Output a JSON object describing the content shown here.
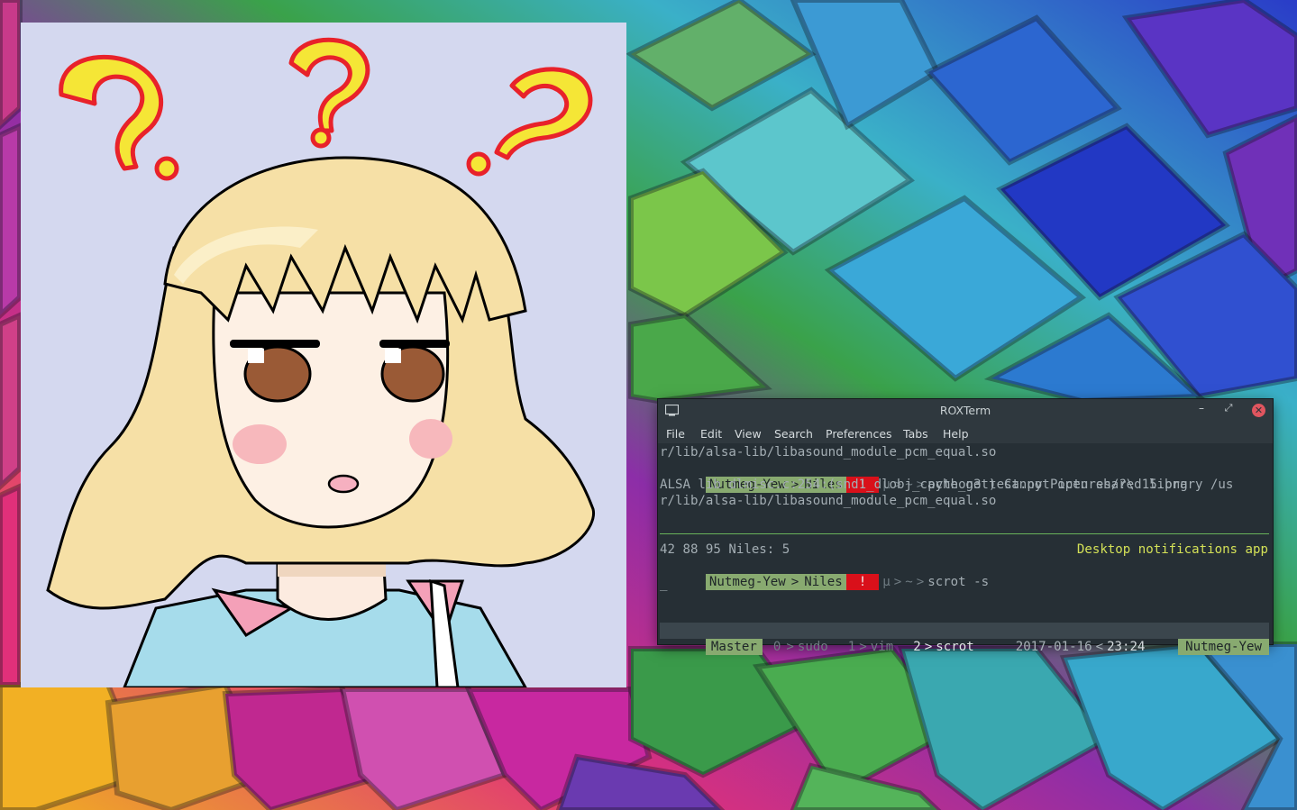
{
  "terminal": {
    "title": "ROXTerm",
    "controls": {
      "minimize": "–",
      "maximize": "⤢",
      "close": "✕"
    },
    "menu": [
      "File",
      "Edit",
      "View",
      "Search",
      "Preferences",
      "Tabs",
      "Help"
    ],
    "lines": {
      "l1": "r/lib/alsa-lib/libasound_module_pcm_equal.so",
      "l3": "ALSA lib dlmisc.c:254:(snd1_dlobj_cache_get) Cannot open shared library /us",
      "l4": "r/lib/alsa-lib/libasound_module_pcm_equal.so",
      "stats": "42 88 95 Niles: 5",
      "notification": "Desktop notifications app",
      "cursor": "_"
    },
    "prompt": {
      "host": "Nutmeg-Yew",
      "user": "Niles",
      "alert": "!",
      "mu": "μ",
      "tilde": "~",
      "command1": "python3 test.py Pictures/?\\ 15.png",
      "command2": "scrot -s"
    },
    "statusbar": {
      "session": "Master",
      "w0_num": "0",
      "w0_name": "sudo",
      "w1_num": "1",
      "w1_name": "vim",
      "w2_num": "2",
      "w2_name": "scrot",
      "date": "2017-01-16",
      "time": "23:24",
      "host": "Nutmeg-Yew"
    }
  },
  "colors": {
    "accent_green": "#88aa70",
    "alert_red": "#d9101a",
    "notification_yellow": "#d4e157",
    "terminal_bg": "#262f35"
  }
}
